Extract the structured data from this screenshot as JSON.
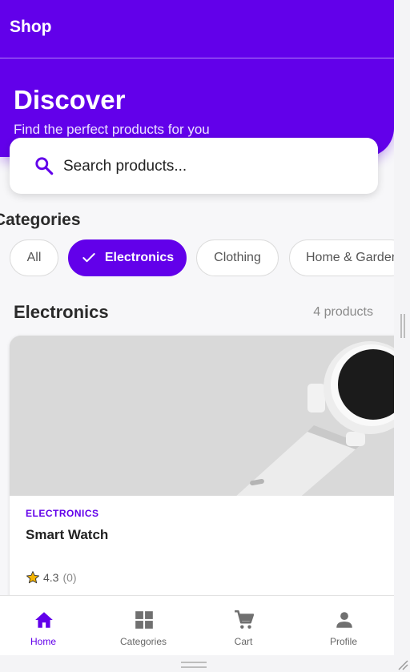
{
  "appbar": {
    "title": "Shop"
  },
  "hero": {
    "title": "Discover",
    "subtitle": "Find the perfect products for you"
  },
  "search": {
    "placeholder": "Search products...",
    "icon": "search-icon"
  },
  "categories": {
    "heading": "Categories",
    "chips": [
      {
        "label": "All",
        "selected": false
      },
      {
        "label": "Electronics",
        "selected": true
      },
      {
        "label": "Clothing",
        "selected": false
      },
      {
        "label": "Home & Garden",
        "selected": false
      }
    ]
  },
  "section": {
    "title": "Electronics",
    "count": "4 products"
  },
  "products": [
    {
      "category": "ELECTRONICS",
      "name": "Smart Watch",
      "rating": "4.3",
      "reviews": "(0)"
    }
  ],
  "bottom_nav": [
    {
      "label": "Home",
      "icon": "home-icon",
      "active": true
    },
    {
      "label": "Categories",
      "icon": "grid-icon",
      "active": false
    },
    {
      "label": "Cart",
      "icon": "cart-icon",
      "active": false
    },
    {
      "label": "Profile",
      "icon": "person-icon",
      "active": false
    }
  ],
  "colors": {
    "primary": "#6200ea",
    "star": "#f5b400",
    "inactive": "#707070"
  }
}
